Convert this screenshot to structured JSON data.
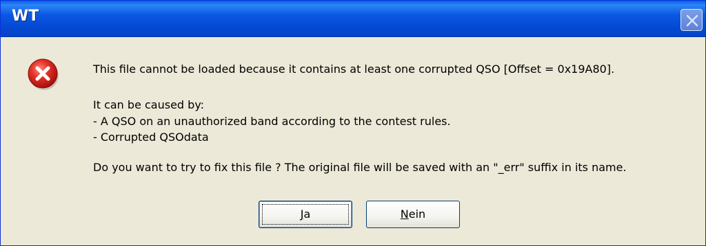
{
  "window": {
    "title": "WT",
    "close_icon": "close-icon"
  },
  "dialog": {
    "icon": "error-icon",
    "icon_color": "#d21f17",
    "line1": "This file cannot be loaded because it contains at least one corrupted QSO [Offset = 0x19A80].",
    "line2": "It can be caused by:",
    "line3": "- A QSO on an unauthorized band according to the contest rules.",
    "line4": "- Corrupted QSOdata",
    "line5": "Do you want to try to fix this file ? The original file will be saved with an \"_err\" suffix in its name."
  },
  "buttons": {
    "yes_mnemonic": "J",
    "yes_rest": "a",
    "no_mnemonic": "N",
    "no_rest": "ein"
  },
  "colors": {
    "titlebar": "#0449d4",
    "dialog_bg": "#ece9d8",
    "button_border": "#003c74"
  }
}
